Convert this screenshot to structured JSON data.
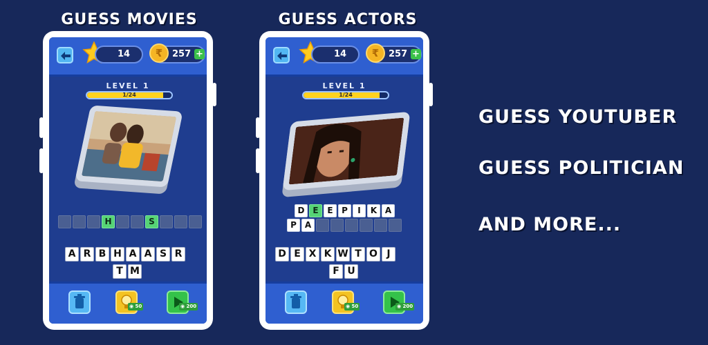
{
  "headings": {
    "left": "GUESS MOVIES",
    "middle": "GUESS ACTORS"
  },
  "right_list": [
    "GUESS YOUTUBER",
    "GUESS POLITICIAN",
    "AND MORE..."
  ],
  "phones": [
    {
      "stars": "14",
      "coins": "257",
      "coin_symbol": "₹",
      "plus": "+",
      "level": "LEVEL 1",
      "progress_text": "1/24",
      "progress_fraction": 0.9,
      "answer_rows": [
        [
          "",
          "",
          "",
          "H",
          "",
          "",
          "S",
          "",
          "",
          ""
        ]
      ],
      "answer_hints": [
        [
          3,
          6
        ]
      ],
      "letter_rows": [
        [
          "A",
          "R",
          "B",
          "H",
          "A",
          "A",
          "S",
          "R"
        ],
        [
          "T",
          "M"
        ]
      ],
      "hint_cost": "50",
      "skip_cost": "200"
    },
    {
      "stars": "14",
      "coins": "257",
      "coin_symbol": "₹",
      "plus": "+",
      "level": "LEVEL 1",
      "progress_text": "1/24",
      "progress_fraction": 0.9,
      "answer_rows": [
        [
          "D",
          "E",
          "E",
          "P",
          "I",
          "K",
          "A"
        ],
        [
          "P",
          "A",
          "",
          "",
          "",
          "",
          "",
          ""
        ]
      ],
      "answer_hints": [
        [
          1
        ],
        []
      ],
      "letter_rows": [
        [
          "D",
          "E",
          "X",
          "K",
          "W",
          "T",
          "O",
          "J"
        ],
        [
          "F",
          "U"
        ]
      ],
      "hint_cost": "50",
      "skip_cost": "200"
    }
  ],
  "colors": {
    "background": "#17285a",
    "topbar": "#2f5fd0",
    "hint_green": "#56d476",
    "progress_fill": "#ffd21f"
  }
}
